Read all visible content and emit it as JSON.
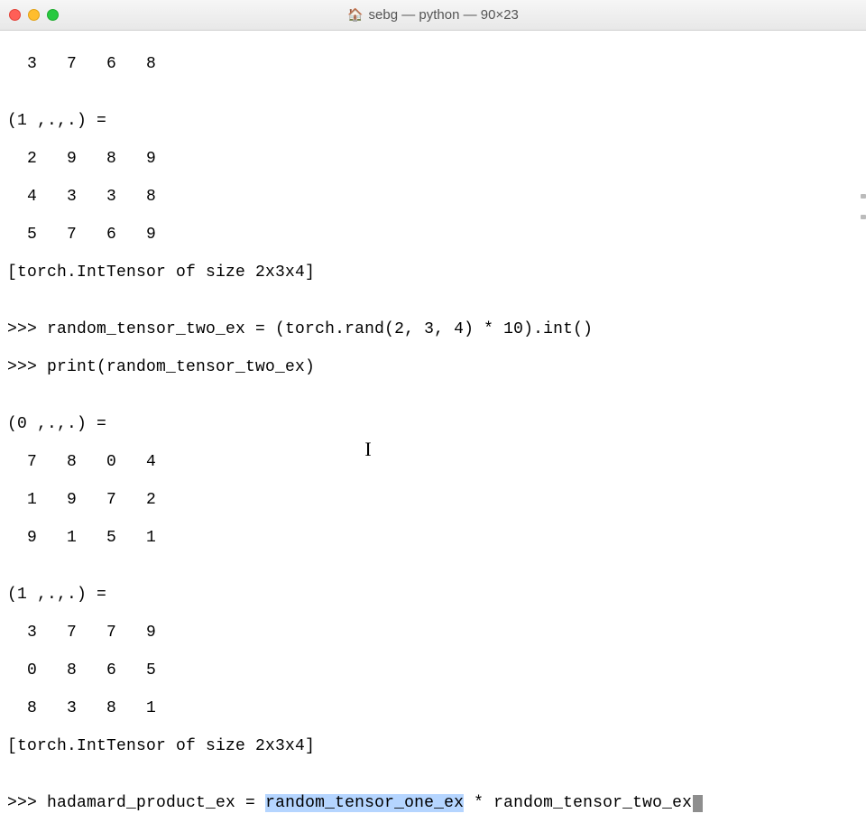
{
  "titlebar": {
    "home_icon": "🏠",
    "title": "sebg — python — 90×23"
  },
  "lines": {
    "l01": "  3   7   6   8",
    "l02": "",
    "l03": "(1 ,.,.) = ",
    "l04": "  2   9   8   9",
    "l05": "  4   3   3   8",
    "l06": "  5   7   6   9",
    "l07": "[torch.IntTensor of size 2x3x4]",
    "l08": "",
    "l09_prompt": ">>> ",
    "l09_code": "random_tensor_two_ex = (torch.rand(2, 3, 4) * 10).int()",
    "l10_prompt": ">>> ",
    "l10_code": "print(random_tensor_two_ex)",
    "l11": "",
    "l12": "(0 ,.,.) = ",
    "l13": "  7   8   0   4",
    "l14": "  1   9   7   2",
    "l15": "  9   1   5   1",
    "l16": "",
    "l17": "(1 ,.,.) = ",
    "l18": "  3   7   7   9",
    "l19": "  0   8   6   5",
    "l20": "  8   3   8   1",
    "l21": "[torch.IntTensor of size 2x3x4]",
    "l22": "",
    "l23_prompt": ">>> ",
    "l23_a": "hadamard_product_ex = ",
    "l23_sel": "random_tensor_one_ex",
    "l23_b": " * random_tensor_two_ex"
  }
}
